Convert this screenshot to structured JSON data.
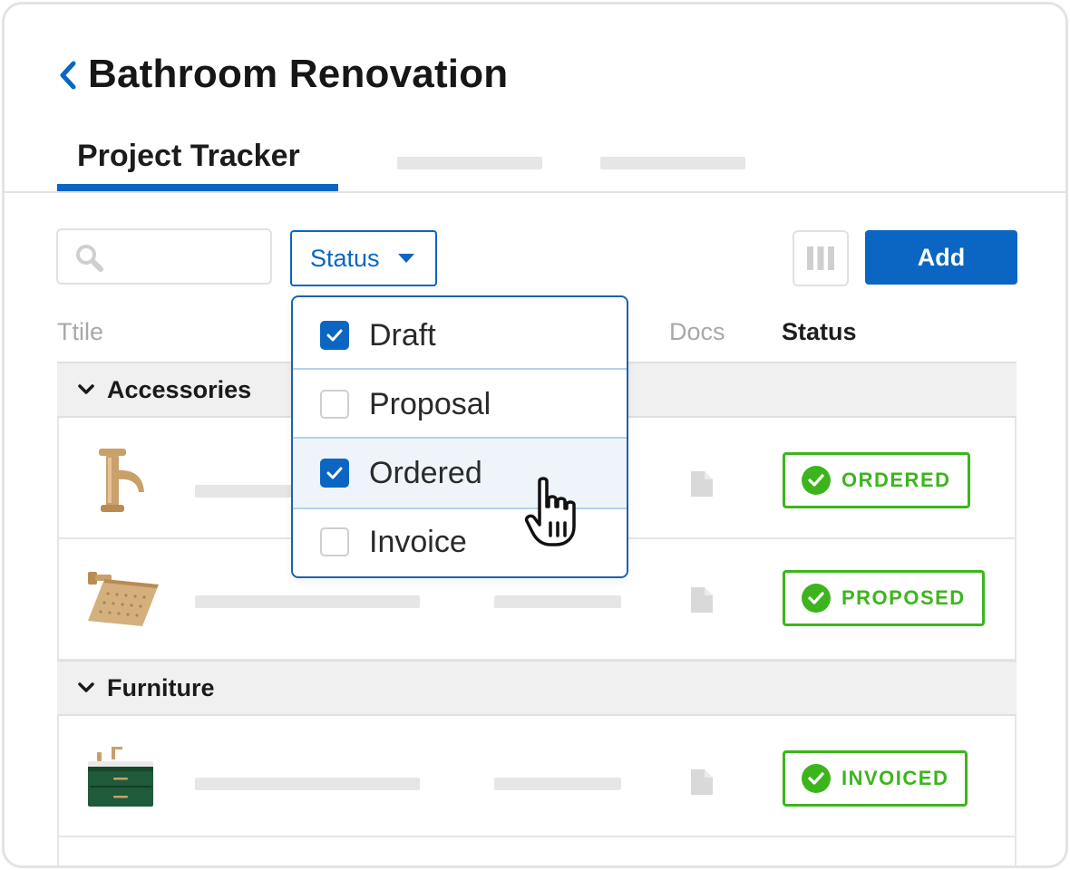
{
  "header": {
    "title": "Bathroom Renovation",
    "back_icon": "chevron-left-icon"
  },
  "tabs": [
    {
      "label": "Project Tracker",
      "active": true
    }
  ],
  "toolbar": {
    "search_icon": "search-icon",
    "status_filter_label": "Status",
    "columns_icon": "columns-icon",
    "add_label": "Add"
  },
  "table": {
    "columns": {
      "title": "Ttile",
      "docs": "Docs",
      "status": "Status"
    },
    "groups": [
      {
        "label": "Accessories",
        "rows": [
          {
            "thumbnail": "faucet",
            "status": "ORDERED"
          },
          {
            "thumbnail": "shower-head",
            "status": "PROPOSED"
          }
        ]
      },
      {
        "label": "Furniture",
        "rows": [
          {
            "thumbnail": "vanity-cabinet",
            "status": "INVOICED"
          }
        ]
      }
    ]
  },
  "status_dropdown": {
    "options": [
      {
        "label": "Draft",
        "checked": true
      },
      {
        "label": "Proposal",
        "checked": false
      },
      {
        "label": "Ordered",
        "checked": true,
        "hovered": true
      },
      {
        "label": "Invoice",
        "checked": false
      }
    ]
  },
  "colors": {
    "accent": "#0a66c2",
    "status_green": "#3cb51d",
    "placeholder_gray": "#e6e6e6",
    "group_background": "#f0f0f0"
  }
}
